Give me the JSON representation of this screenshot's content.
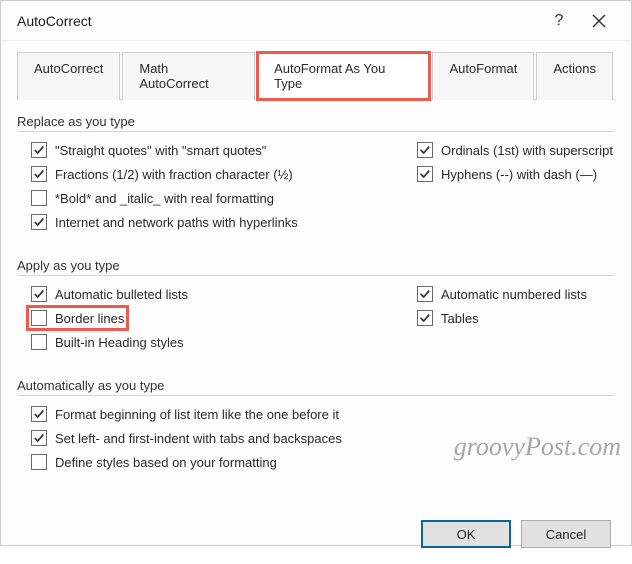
{
  "title": "AutoCorrect",
  "tabs": [
    {
      "label": "AutoCorrect",
      "active": false
    },
    {
      "label": "Math AutoCorrect",
      "active": false
    },
    {
      "label": "AutoFormat As You Type",
      "active": true,
      "highlighted": true
    },
    {
      "label": "AutoFormat",
      "active": false
    },
    {
      "label": "Actions",
      "active": false
    }
  ],
  "sections": {
    "replace": {
      "header": "Replace as you type",
      "left": [
        {
          "label": "\"Straight quotes\" with \"smart quotes\"",
          "checked": true
        },
        {
          "label": "Fractions (1/2) with fraction character (½)",
          "checked": true
        },
        {
          "label": "*Bold* and _italic_ with real formatting",
          "checked": false
        },
        {
          "label": "Internet and network paths with hyperlinks",
          "checked": true
        }
      ],
      "right": [
        {
          "label": "Ordinals (1st) with superscript",
          "checked": true
        },
        {
          "label": "Hyphens (--) with dash (—)",
          "checked": true
        }
      ]
    },
    "apply": {
      "header": "Apply as you type",
      "left": [
        {
          "label": "Automatic bulleted lists",
          "checked": true
        },
        {
          "label": "Border lines",
          "checked": false,
          "highlighted": true
        },
        {
          "label": "Built-in Heading styles",
          "checked": false
        }
      ],
      "right": [
        {
          "label": "Automatic numbered lists",
          "checked": true
        },
        {
          "label": "Tables",
          "checked": true
        }
      ]
    },
    "auto": {
      "header": "Automatically as you type",
      "left": [
        {
          "label": "Format beginning of list item like the one before it",
          "checked": true
        },
        {
          "label": "Set left- and first-indent with tabs and backspaces",
          "checked": true
        },
        {
          "label": "Define styles based on your formatting",
          "checked": false
        }
      ]
    }
  },
  "buttons": {
    "ok": "OK",
    "cancel": "Cancel"
  },
  "watermark": "groovyPost.com"
}
